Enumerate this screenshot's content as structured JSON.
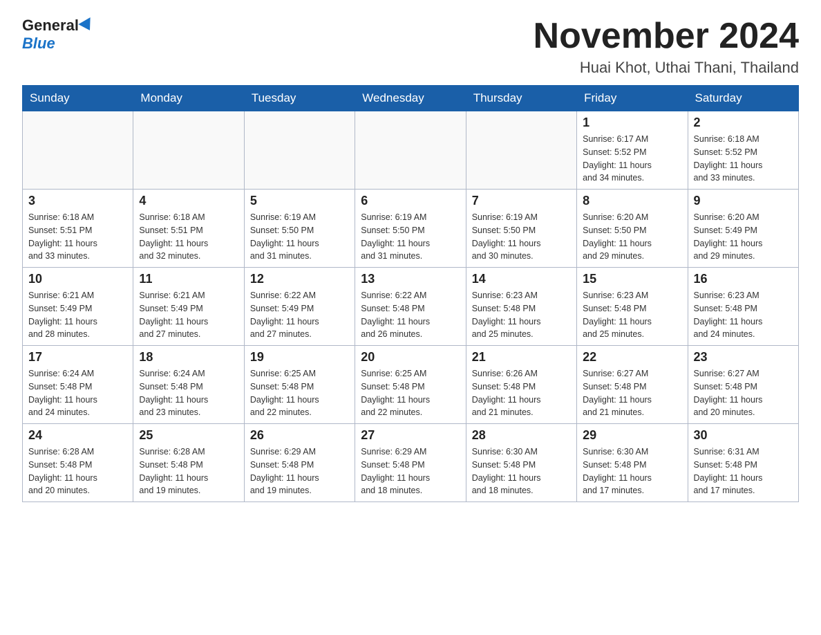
{
  "logo": {
    "general": "General",
    "blue": "Blue"
  },
  "title": "November 2024",
  "location": "Huai Khot, Uthai Thani, Thailand",
  "days_of_week": [
    "Sunday",
    "Monday",
    "Tuesday",
    "Wednesday",
    "Thursday",
    "Friday",
    "Saturday"
  ],
  "weeks": [
    [
      {
        "day": "",
        "info": ""
      },
      {
        "day": "",
        "info": ""
      },
      {
        "day": "",
        "info": ""
      },
      {
        "day": "",
        "info": ""
      },
      {
        "day": "",
        "info": ""
      },
      {
        "day": "1",
        "info": "Sunrise: 6:17 AM\nSunset: 5:52 PM\nDaylight: 11 hours\nand 34 minutes."
      },
      {
        "day": "2",
        "info": "Sunrise: 6:18 AM\nSunset: 5:52 PM\nDaylight: 11 hours\nand 33 minutes."
      }
    ],
    [
      {
        "day": "3",
        "info": "Sunrise: 6:18 AM\nSunset: 5:51 PM\nDaylight: 11 hours\nand 33 minutes."
      },
      {
        "day": "4",
        "info": "Sunrise: 6:18 AM\nSunset: 5:51 PM\nDaylight: 11 hours\nand 32 minutes."
      },
      {
        "day": "5",
        "info": "Sunrise: 6:19 AM\nSunset: 5:50 PM\nDaylight: 11 hours\nand 31 minutes."
      },
      {
        "day": "6",
        "info": "Sunrise: 6:19 AM\nSunset: 5:50 PM\nDaylight: 11 hours\nand 31 minutes."
      },
      {
        "day": "7",
        "info": "Sunrise: 6:19 AM\nSunset: 5:50 PM\nDaylight: 11 hours\nand 30 minutes."
      },
      {
        "day": "8",
        "info": "Sunrise: 6:20 AM\nSunset: 5:50 PM\nDaylight: 11 hours\nand 29 minutes."
      },
      {
        "day": "9",
        "info": "Sunrise: 6:20 AM\nSunset: 5:49 PM\nDaylight: 11 hours\nand 29 minutes."
      }
    ],
    [
      {
        "day": "10",
        "info": "Sunrise: 6:21 AM\nSunset: 5:49 PM\nDaylight: 11 hours\nand 28 minutes."
      },
      {
        "day": "11",
        "info": "Sunrise: 6:21 AM\nSunset: 5:49 PM\nDaylight: 11 hours\nand 27 minutes."
      },
      {
        "day": "12",
        "info": "Sunrise: 6:22 AM\nSunset: 5:49 PM\nDaylight: 11 hours\nand 27 minutes."
      },
      {
        "day": "13",
        "info": "Sunrise: 6:22 AM\nSunset: 5:48 PM\nDaylight: 11 hours\nand 26 minutes."
      },
      {
        "day": "14",
        "info": "Sunrise: 6:23 AM\nSunset: 5:48 PM\nDaylight: 11 hours\nand 25 minutes."
      },
      {
        "day": "15",
        "info": "Sunrise: 6:23 AM\nSunset: 5:48 PM\nDaylight: 11 hours\nand 25 minutes."
      },
      {
        "day": "16",
        "info": "Sunrise: 6:23 AM\nSunset: 5:48 PM\nDaylight: 11 hours\nand 24 minutes."
      }
    ],
    [
      {
        "day": "17",
        "info": "Sunrise: 6:24 AM\nSunset: 5:48 PM\nDaylight: 11 hours\nand 24 minutes."
      },
      {
        "day": "18",
        "info": "Sunrise: 6:24 AM\nSunset: 5:48 PM\nDaylight: 11 hours\nand 23 minutes."
      },
      {
        "day": "19",
        "info": "Sunrise: 6:25 AM\nSunset: 5:48 PM\nDaylight: 11 hours\nand 22 minutes."
      },
      {
        "day": "20",
        "info": "Sunrise: 6:25 AM\nSunset: 5:48 PM\nDaylight: 11 hours\nand 22 minutes."
      },
      {
        "day": "21",
        "info": "Sunrise: 6:26 AM\nSunset: 5:48 PM\nDaylight: 11 hours\nand 21 minutes."
      },
      {
        "day": "22",
        "info": "Sunrise: 6:27 AM\nSunset: 5:48 PM\nDaylight: 11 hours\nand 21 minutes."
      },
      {
        "day": "23",
        "info": "Sunrise: 6:27 AM\nSunset: 5:48 PM\nDaylight: 11 hours\nand 20 minutes."
      }
    ],
    [
      {
        "day": "24",
        "info": "Sunrise: 6:28 AM\nSunset: 5:48 PM\nDaylight: 11 hours\nand 20 minutes."
      },
      {
        "day": "25",
        "info": "Sunrise: 6:28 AM\nSunset: 5:48 PM\nDaylight: 11 hours\nand 19 minutes."
      },
      {
        "day": "26",
        "info": "Sunrise: 6:29 AM\nSunset: 5:48 PM\nDaylight: 11 hours\nand 19 minutes."
      },
      {
        "day": "27",
        "info": "Sunrise: 6:29 AM\nSunset: 5:48 PM\nDaylight: 11 hours\nand 18 minutes."
      },
      {
        "day": "28",
        "info": "Sunrise: 6:30 AM\nSunset: 5:48 PM\nDaylight: 11 hours\nand 18 minutes."
      },
      {
        "day": "29",
        "info": "Sunrise: 6:30 AM\nSunset: 5:48 PM\nDaylight: 11 hours\nand 17 minutes."
      },
      {
        "day": "30",
        "info": "Sunrise: 6:31 AM\nSunset: 5:48 PM\nDaylight: 11 hours\nand 17 minutes."
      }
    ]
  ]
}
